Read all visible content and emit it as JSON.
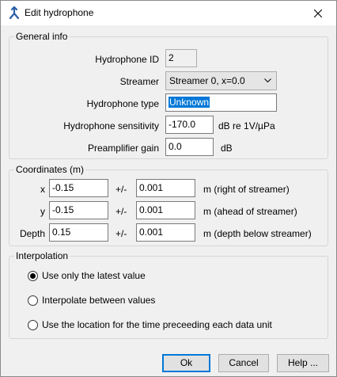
{
  "window": {
    "title": "Edit hydrophone",
    "icon": "hydrophone-app-icon",
    "close_icon": "close-icon"
  },
  "general": {
    "legend": "General info",
    "id_label": "Hydrophone ID",
    "id_value": "2",
    "streamer_label": "Streamer",
    "streamer_value": "Streamer 0, x=0.0",
    "type_label": "Hydrophone type",
    "type_value": "Unknown",
    "sensitivity_label": "Hydrophone sensitivity",
    "sensitivity_value": "-170.0",
    "sensitivity_unit": "dB re 1V/µPa",
    "gain_label": "Preamplifier gain",
    "gain_value": "0.0",
    "gain_unit": "dB"
  },
  "coords": {
    "legend": "Coordinates (m)",
    "pm": "+/-",
    "rows": [
      {
        "label": "x",
        "value": "-0.15",
        "error": "0.001",
        "desc": "m (right of streamer)"
      },
      {
        "label": "y",
        "value": "-0.15",
        "error": "0.001",
        "desc": "m (ahead of streamer)"
      },
      {
        "label": "Depth",
        "value": "0.15",
        "error": "0.001",
        "desc": "m (depth below streamer)"
      }
    ]
  },
  "interp": {
    "legend": "Interpolation",
    "options": [
      {
        "label": "Use only the latest value",
        "selected": true
      },
      {
        "label": "Interpolate between values",
        "selected": false
      },
      {
        "label": "Use the location for the time preceeding each data unit",
        "selected": false
      }
    ]
  },
  "buttons": {
    "ok": "Ok",
    "cancel": "Cancel",
    "help": "Help ..."
  },
  "colors": {
    "selection": "#0078d7",
    "default_button_border": "#0078d7",
    "app_icon": "#2a5fa8"
  }
}
